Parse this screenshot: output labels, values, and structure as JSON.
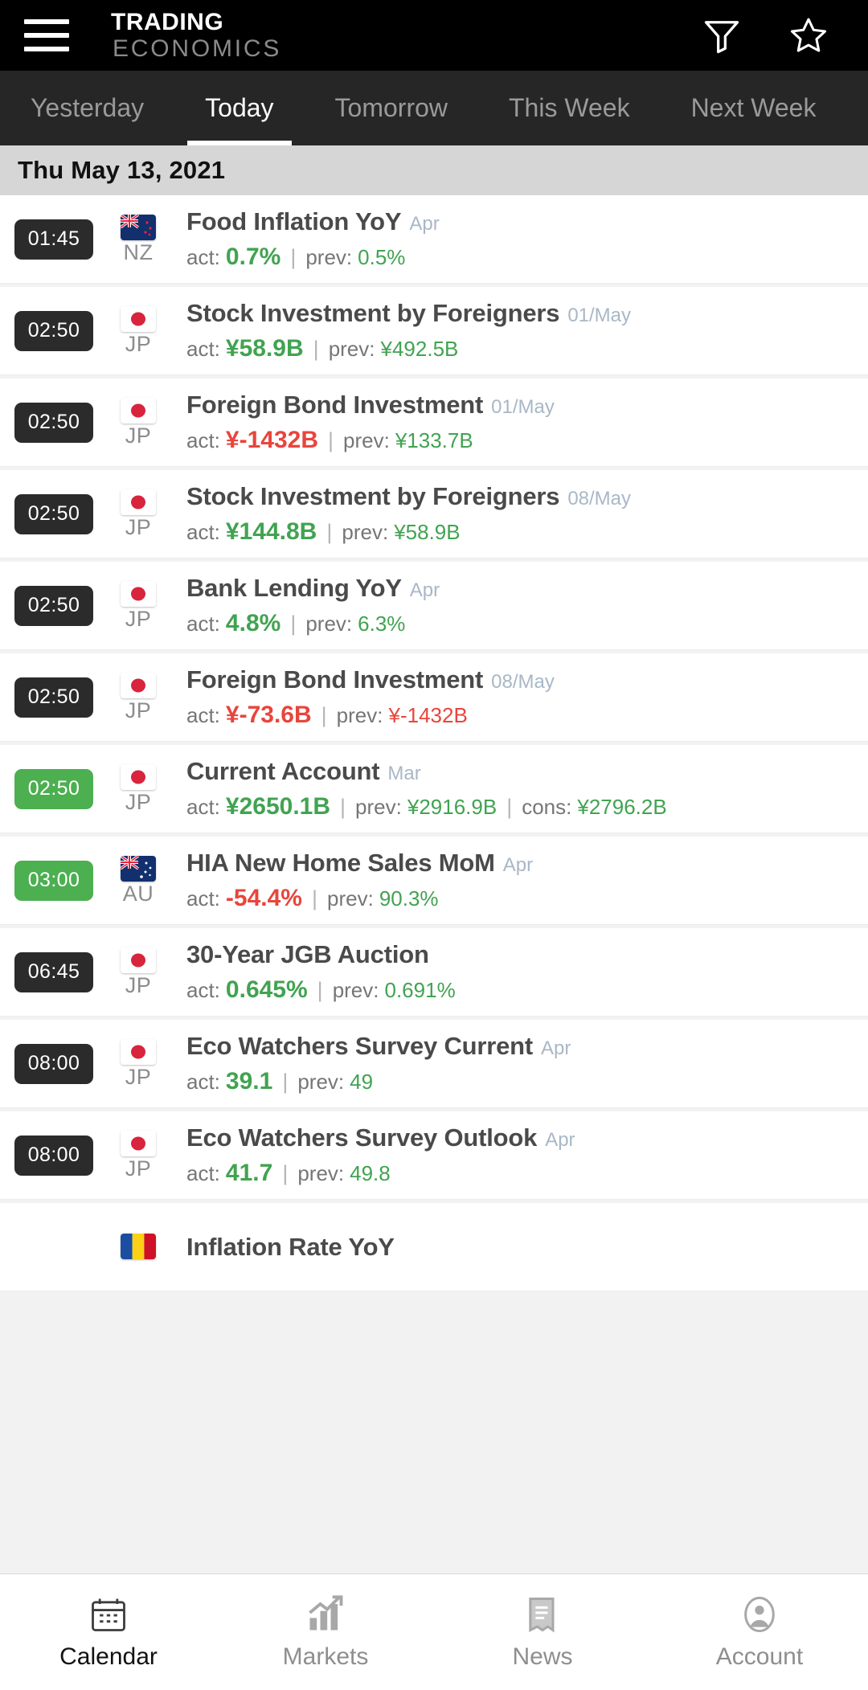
{
  "header": {
    "menu_icon": "hamburger-menu-icon",
    "brand_line1": "TRADING",
    "brand_line2": "ECONOMICS",
    "filter_icon": "filter-funnel-icon",
    "favorite_icon": "star-icon"
  },
  "tabs": {
    "items": [
      {
        "label": "Yesterday",
        "active": false
      },
      {
        "label": "Today",
        "active": true
      },
      {
        "label": "Tomorrow",
        "active": false
      },
      {
        "label": "This Week",
        "active": false
      },
      {
        "label": "Next Week",
        "active": false
      }
    ]
  },
  "date_header": {
    "label": "Thu May 13, 2021"
  },
  "labels": {
    "actual": "act:",
    "previous": "prev:",
    "consensus": "cons:",
    "separator": "|"
  },
  "events": [
    {
      "time": "01:45",
      "time_highlight": false,
      "country_code": "NZ",
      "flag": "new-zealand-flag",
      "event": "Food Inflation YoY",
      "period": "Apr",
      "actual": "0.7%",
      "actual_dir": "pos",
      "previous": "0.5%",
      "previous_dir": "pos",
      "consensus": null,
      "consensus_dir": null
    },
    {
      "time": "02:50",
      "time_highlight": false,
      "country_code": "JP",
      "flag": "japan-flag",
      "event": "Stock Investment by Foreigners",
      "period": "01/May",
      "actual": "¥58.9B",
      "actual_dir": "pos",
      "previous": "¥492.5B",
      "previous_dir": "pos",
      "consensus": null,
      "consensus_dir": null
    },
    {
      "time": "02:50",
      "time_highlight": false,
      "country_code": "JP",
      "flag": "japan-flag",
      "event": "Foreign Bond Investment",
      "period": "01/May",
      "actual": "¥-1432B",
      "actual_dir": "neg",
      "previous": "¥133.7B",
      "previous_dir": "pos",
      "consensus": null,
      "consensus_dir": null
    },
    {
      "time": "02:50",
      "time_highlight": false,
      "country_code": "JP",
      "flag": "japan-flag",
      "event": "Stock Investment by Foreigners",
      "period": "08/May",
      "actual": "¥144.8B",
      "actual_dir": "pos",
      "previous": "¥58.9B",
      "previous_dir": "pos",
      "consensus": null,
      "consensus_dir": null
    },
    {
      "time": "02:50",
      "time_highlight": false,
      "country_code": "JP",
      "flag": "japan-flag",
      "event": "Bank Lending YoY",
      "period": "Apr",
      "actual": "4.8%",
      "actual_dir": "pos",
      "previous": "6.3%",
      "previous_dir": "pos",
      "consensus": null,
      "consensus_dir": null
    },
    {
      "time": "02:50",
      "time_highlight": false,
      "country_code": "JP",
      "flag": "japan-flag",
      "event": "Foreign Bond Investment",
      "period": "08/May",
      "actual": "¥-73.6B",
      "actual_dir": "neg",
      "previous": "¥-1432B",
      "previous_dir": "neg",
      "consensus": null,
      "consensus_dir": null
    },
    {
      "time": "02:50",
      "time_highlight": true,
      "country_code": "JP",
      "flag": "japan-flag",
      "event": "Current Account",
      "period": "Mar",
      "actual": "¥2650.1B",
      "actual_dir": "pos",
      "previous": "¥2916.9B",
      "previous_dir": "pos",
      "consensus": "¥2796.2B",
      "consensus_dir": "pos"
    },
    {
      "time": "03:00",
      "time_highlight": true,
      "country_code": "AU",
      "flag": "australia-flag",
      "event": "HIA New Home Sales MoM",
      "period": "Apr",
      "actual": "-54.4%",
      "actual_dir": "neg",
      "previous": "90.3%",
      "previous_dir": "pos",
      "consensus": null,
      "consensus_dir": null
    },
    {
      "time": "06:45",
      "time_highlight": false,
      "country_code": "JP",
      "flag": "japan-flag",
      "event": "30-Year JGB Auction",
      "period": "",
      "actual": "0.645%",
      "actual_dir": "pos",
      "previous": "0.691%",
      "previous_dir": "pos",
      "consensus": null,
      "consensus_dir": null
    },
    {
      "time": "08:00",
      "time_highlight": false,
      "country_code": "JP",
      "flag": "japan-flag",
      "event": "Eco Watchers Survey Current",
      "period": "Apr",
      "actual": "39.1",
      "actual_dir": "pos",
      "previous": "49",
      "previous_dir": "pos",
      "consensus": null,
      "consensus_dir": null
    },
    {
      "time": "08:00",
      "time_highlight": false,
      "country_code": "JP",
      "flag": "japan-flag",
      "event": "Eco Watchers Survey Outlook",
      "period": "Apr",
      "actual": "41.7",
      "actual_dir": "pos",
      "previous": "49.8",
      "previous_dir": "pos",
      "consensus": null,
      "consensus_dir": null
    },
    {
      "time": "",
      "time_highlight": false,
      "country_code": "",
      "flag": "romania-flag",
      "event": "Inflation Rate YoY",
      "period": "",
      "actual": null,
      "actual_dir": null,
      "previous": null,
      "previous_dir": null,
      "consensus": null,
      "consensus_dir": null
    }
  ],
  "bottom_nav": {
    "items": [
      {
        "label": "Calendar",
        "icon": "calendar-icon",
        "active": true
      },
      {
        "label": "Markets",
        "icon": "chart-bars-icon",
        "active": false
      },
      {
        "label": "News",
        "icon": "newspaper-icon",
        "active": false
      },
      {
        "label": "Account",
        "icon": "user-circle-icon",
        "active": false
      }
    ]
  },
  "colors": {
    "positive": "#41a351",
    "negative": "#e8453c",
    "time_badge": "#2b2b2b",
    "time_badge_highlight": "#4CAF50",
    "topbar": "#000000",
    "tabbar": "#262626",
    "date_header": "#d6d6d6"
  }
}
